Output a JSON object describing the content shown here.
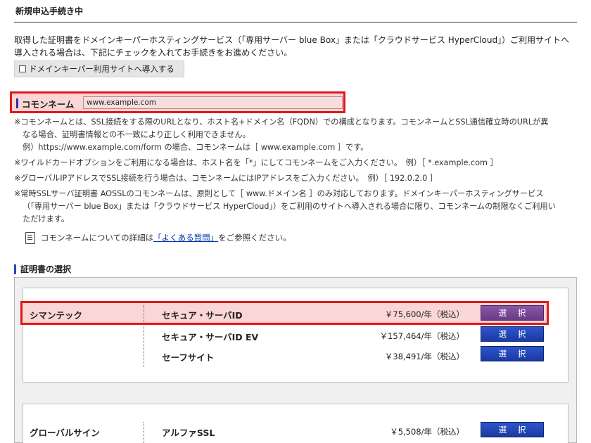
{
  "page": {
    "title": "新規申込手続き中"
  },
  "intro": {
    "text": "取得した証明書をドメインキーパーホスティングサービス（「専用サーバー blue Box」または「クラウドサービス HyperCloud」）ご利用サイトへ導入される場合は、下記にチェックを入れてお手続きをお進めください。"
  },
  "dk_checkbox": {
    "label": "ドメインキーパー利用サイトへ導入する"
  },
  "common_name": {
    "label": "コモンネーム",
    "value": "www.example.com"
  },
  "notes": {
    "n1_line1": "※コモンネームとは、SSL接続をする際のURLとなり、ホスト名+ドメイン名（FQDN）での構成となります。コモンネームとSSL通信確立時のURLが異",
    "n1_line2": "なる場合、証明書情報との不一致により正しく利用できません。",
    "n1_line3": "例）https://www.example.com/form の場合、コモンネームは［ www.example.com ］です。",
    "n2": "※ワイルドカードオプションをご利用になる場合は、ホスト名を「*」にしてコモンネームをご入力ください。　例）［ *.example.com ］",
    "n3": "※グローバルIPアドレスでSSL接続を行う場合は、コモンネームにはIPアドレスをご入力ください。　例）［ 192.0.2.0 ］",
    "n4_line1": "※常時SSLサーバ証明書 AOSSLのコモンネームは、原則として［ www.ドメイン名 ］のみ対応しております。ドメインキーパーホスティングサービス",
    "n4_line2": "（「専用サーバー blue Box」または「クラウドサービス HyperCloud」）をご利用のサイトへ導入される場合に限り、コモンネームの制限なくご利用い",
    "n4_line3": "ただけます。"
  },
  "faq": {
    "prefix": "コモンネームについての詳細は",
    "link": "「よくある質問」",
    "suffix": "をご参照ください。"
  },
  "cert_section": {
    "heading": "証明書の選択",
    "button_label": "選 択",
    "vendors": [
      {
        "name": "シマンテック",
        "products": [
          {
            "name": "セキュア・サーバID",
            "price": "￥75,600/年（税込）"
          },
          {
            "name": "セキュア・サーバID EV",
            "price": "￥157,464/年（税込）"
          },
          {
            "name": "セーフサイト",
            "price": "￥38,491/年（税込）"
          }
        ]
      },
      {
        "name": "グローバルサイン",
        "products": [
          {
            "name": "アルファSSL",
            "price": "￥5,508/年（税込）"
          }
        ]
      }
    ]
  }
}
